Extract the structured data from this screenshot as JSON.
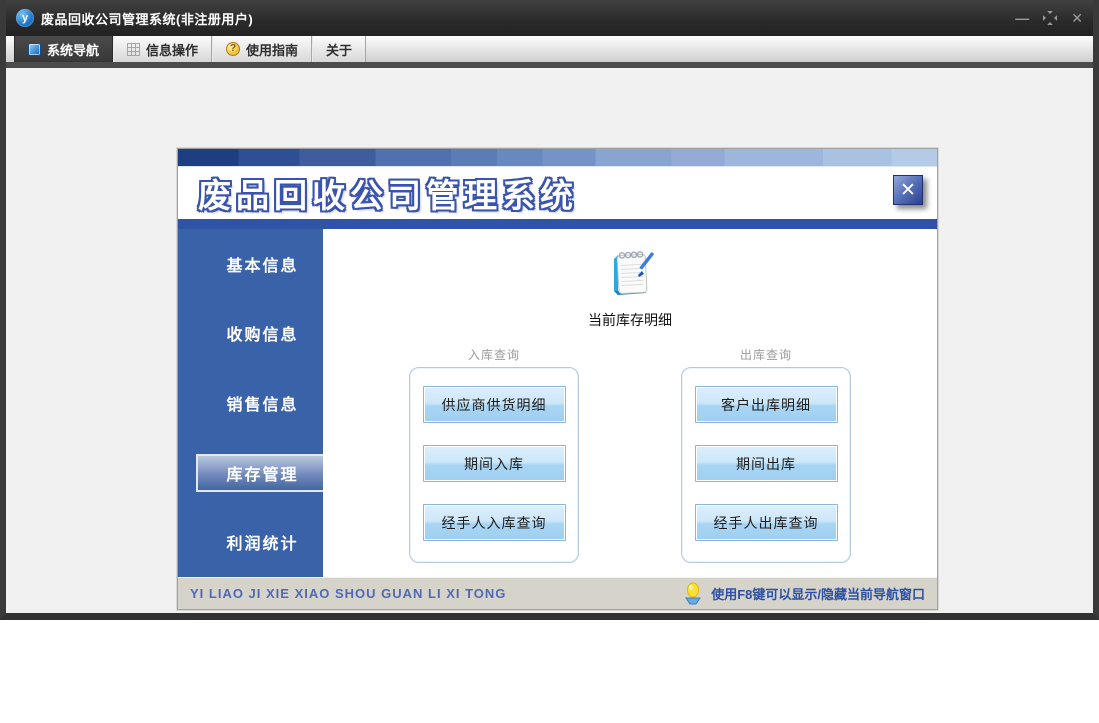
{
  "titlebar": {
    "title": "废品回收公司管理系统(非注册用户)",
    "icon_letter": "y",
    "minimize_glyph": "—",
    "close_glyph": "✕"
  },
  "tabs": [
    {
      "label": "系统导航",
      "icon": "monitor-icon",
      "active": true
    },
    {
      "label": "信息操作",
      "icon": "grid-icon",
      "active": false
    },
    {
      "label": "使用指南",
      "icon": "help-coin-icon",
      "active": false
    },
    {
      "label": "关于",
      "icon": "",
      "active": false
    }
  ],
  "glyphs": {
    "question": "?"
  },
  "window": {
    "title": "废品回收公司管理系统",
    "close_glyph": "✕",
    "sidebar": {
      "items": [
        {
          "label": "基本信息",
          "active": false
        },
        {
          "label": "收购信息",
          "active": false
        },
        {
          "label": "销售信息",
          "active": false
        },
        {
          "label": "库存管理",
          "active": true
        },
        {
          "label": "利润统计",
          "active": false
        }
      ]
    },
    "content": {
      "stock_icon": "notepad-pen-icon",
      "stock_label": "当前库存明细",
      "groups": [
        {
          "label": "入库查询",
          "buttons": [
            "供应商供货明细",
            "期间入库",
            "经手人入库查询"
          ]
        },
        {
          "label": "出库查询",
          "buttons": [
            "客户出库明细",
            "期间出库",
            "经手人出库查询"
          ]
        }
      ]
    },
    "statusbar": {
      "left_text": "YI LIAO JI XIE XIAO SHOU GUAN LI XI TONG",
      "hint_icon": "lightbulb-icon",
      "right_text": "使用F8键可以显示/隐藏当前导航窗口"
    }
  },
  "colors": {
    "sidebar_blue": "#3a62a9",
    "header_bar_blue": "#2e54a3",
    "button_face_blue": "#9ecff1",
    "button_border_blue": "#8ab4d8",
    "status_bar_tan": "#d6d3ca",
    "status_text_blue": "#5069b5",
    "active_tab_dark": "#3e3e3e",
    "gradient_bar_start": "#1d3e80",
    "gradient_bar_end": "#b4cbe8"
  }
}
